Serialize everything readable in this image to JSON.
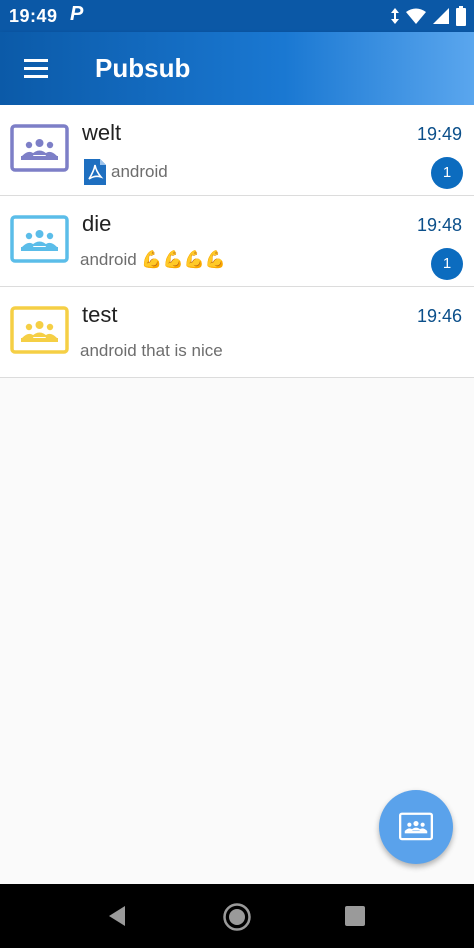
{
  "status_bar": {
    "time": "19:49",
    "notification_glyph": "P",
    "icons": [
      "data-arrows-icon",
      "wifi-icon",
      "signal-icon",
      "battery-icon"
    ]
  },
  "app_bar": {
    "title": "Pubsub",
    "menu_icon": "menu-icon",
    "color": "#0b5aa8"
  },
  "chats": [
    {
      "name": "welt",
      "time": "19:49",
      "preview": "android",
      "attachment_icon": "pdf-icon",
      "badge": "1",
      "avatar_color": "#7d7fc7"
    },
    {
      "name": "die",
      "time": "19:48",
      "preview": "android 💪💪💪💪",
      "badge": "1",
      "avatar_color": "#5bbde9"
    },
    {
      "name": "test",
      "time": "19:46",
      "preview": "android that is nice",
      "avatar_color": "#f5cf45"
    }
  ],
  "fab": {
    "icon": "group-chat-icon",
    "color": "#5aa2eb"
  },
  "nav_bar": {
    "icons": [
      "back-icon",
      "home-icon",
      "recents-icon"
    ]
  }
}
